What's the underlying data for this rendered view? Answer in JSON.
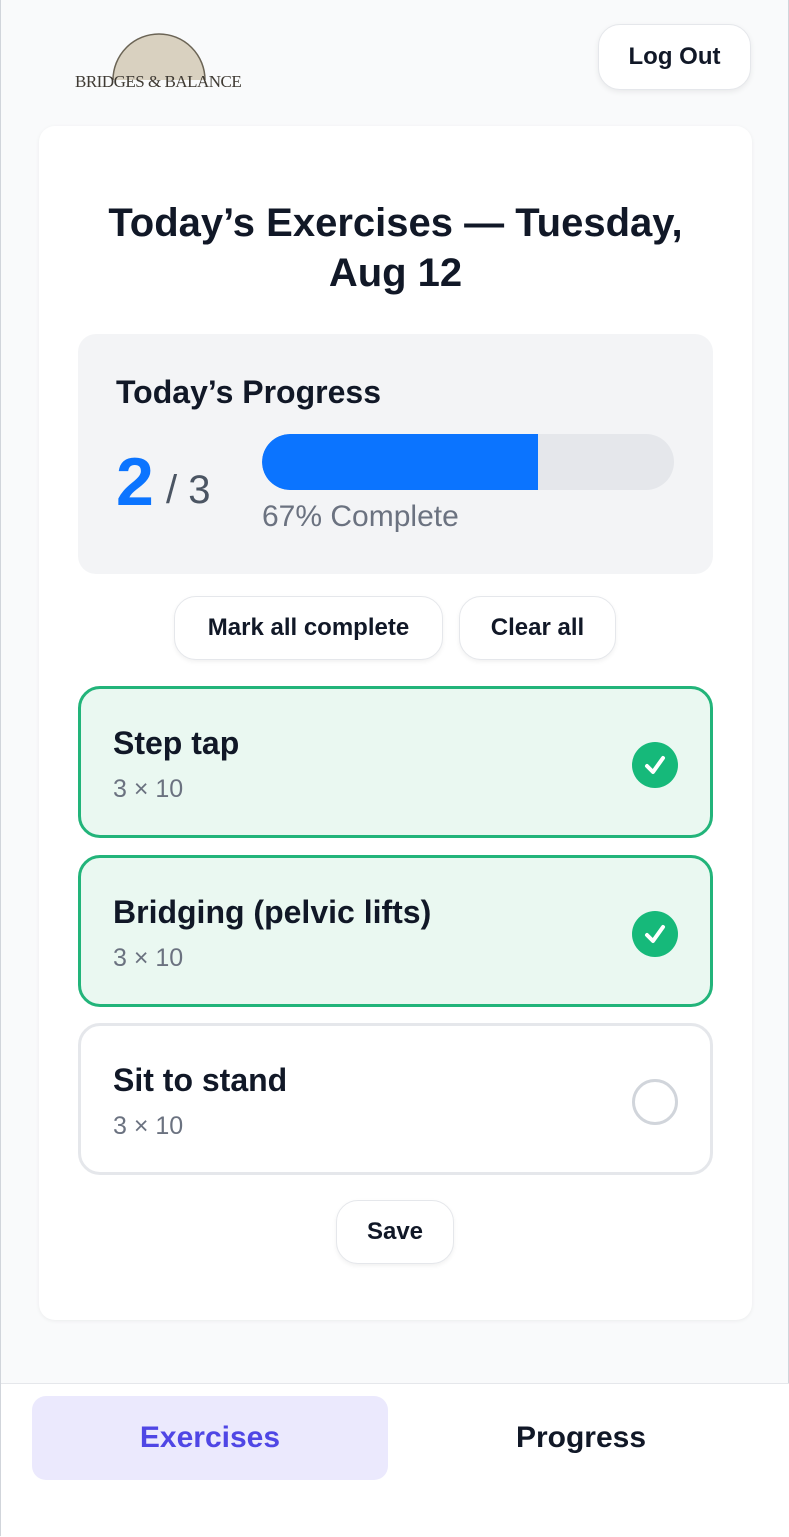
{
  "brand": {
    "name": "BRIDGES & BALANCE",
    "logo_icon": "sunrise-arch-logo"
  },
  "header": {
    "logout_label": "Log Out"
  },
  "page": {
    "title": "Today’s Exercises — Tuesday, Aug 12"
  },
  "progress": {
    "label": "Today’s Progress",
    "done": "2",
    "total": "/ 3",
    "fraction": 0.67,
    "percent_text": "67% Complete",
    "bar_color": "#0b74ff"
  },
  "actions": {
    "mark_all": "Mark all complete",
    "clear_all": "Clear all",
    "save": "Save"
  },
  "exercises": [
    {
      "name": "Step tap",
      "reps": "3 × 10",
      "completed": true
    },
    {
      "name": "Bridging (pelvic lifts)",
      "reps": "3 × 10",
      "completed": true
    },
    {
      "name": "Sit to stand",
      "reps": "3 × 10",
      "completed": false
    }
  ],
  "nav": {
    "items": [
      {
        "label": "Exercises",
        "active": true
      },
      {
        "label": "Progress",
        "active": false
      }
    ]
  },
  "colors": {
    "accent": "#4f46e5",
    "success": "#16b97a",
    "primary": "#0b74ff"
  }
}
